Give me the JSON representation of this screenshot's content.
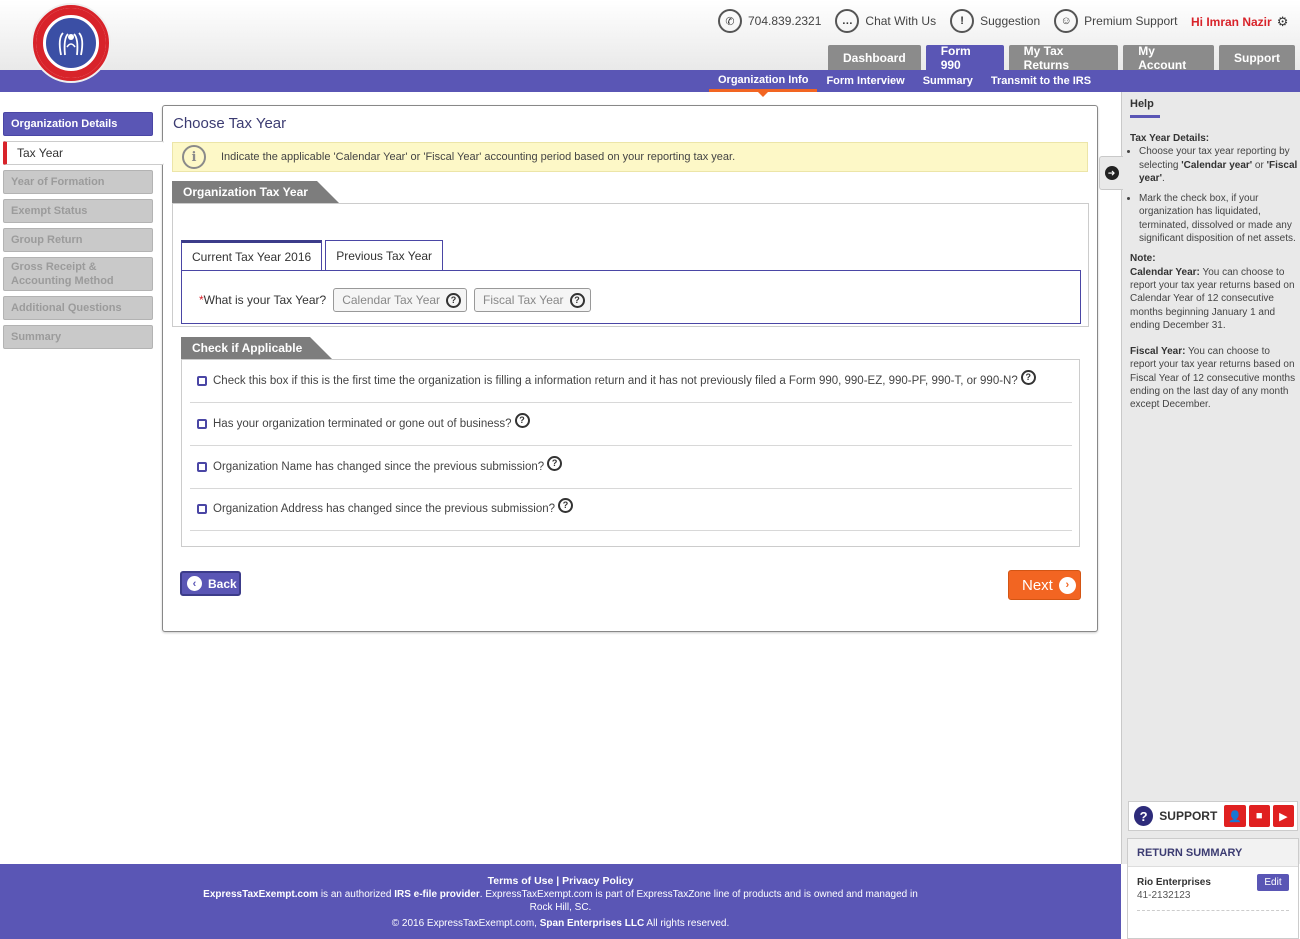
{
  "header": {
    "contact": {
      "phone": "704.839.2321",
      "chat": "Chat With Us",
      "suggestion": "Suggestion",
      "premium": "Premium Support"
    },
    "user_greeting": "Hi Imran Nazir",
    "main_tabs": [
      "Dashboard",
      "Form 990",
      "My Tax Returns",
      "My Account",
      "Support"
    ],
    "active_main_tab": "Form 990",
    "sub_nav": [
      "Organization Info",
      "Form Interview",
      "Summary",
      "Transmit to the IRS"
    ],
    "active_sub_nav": "Organization Info"
  },
  "sidebar": {
    "items": [
      "Organization Details",
      "Tax Year",
      "Year of Formation",
      "Exempt Status",
      "Group Return",
      "Gross Receipt & Accounting Method",
      "Additional Questions",
      "Summary"
    ]
  },
  "main": {
    "title": "Choose Tax Year",
    "info": "Indicate the applicable 'Calendar Year' or 'Fiscal Year' accounting period based on your reporting tax year.",
    "section1": "Organization Tax Year",
    "tabs": [
      "Current Tax Year 2016",
      "Previous Tax Year"
    ],
    "question": "What is your Tax Year?",
    "required_mark": "*",
    "options": [
      "Calendar Tax Year",
      "Fiscal Tax Year"
    ],
    "section2": "Check if Applicable",
    "checks": [
      "Check this box if this is the first time the organization is filling a information return and it has not previously filed a Form 990, 990-EZ, 990-PF, 990-T, or 990-N?",
      "Has your organization terminated or gone out of business?",
      "Organization Name has changed since the previous submission?",
      "Organization Address has changed since the previous submission?"
    ],
    "back_label": "Back",
    "next_label": "Next"
  },
  "help": {
    "title": "Help",
    "tax_year_details_label": "Tax Year Details:",
    "bullet1_pre": "Choose your tax year reporting by selecting ",
    "bullet1_b1": "'Calendar year'",
    "bullet1_mid": " or ",
    "bullet1_b2": "'Fiscal year'",
    "bullet1_post": ".",
    "bullet2": "Mark the check box, if your organization has liquidated, terminated, dissolved or made any significant disposition of net assets.",
    "note_label": "Note:",
    "calendar_label": "Calendar Year:",
    "calendar_text": " You can choose to report your tax year returns based on Calendar Year of 12 consecutive months beginning January 1 and ending December 31.",
    "fiscal_label": "Fiscal Year:",
    "fiscal_text": " You can choose to report your tax year returns based on Fiscal Year of 12 consecutive months ending on the last day of any month except December."
  },
  "support_box": {
    "label": "SUPPORT"
  },
  "return_summary": {
    "title": "RETURN SUMMARY",
    "org_name": "Rio Enterprises",
    "ein": "41-2132123",
    "edit_label": "Edit"
  },
  "footer": {
    "terms": "Terms of Use",
    "sep": "|",
    "privacy": "Privacy Policy",
    "site": "ExpressTaxExempt.com",
    "line2_a": " is an authorized ",
    "irs": "IRS e-file provider",
    "line2_b": ". ExpressTaxExempt.com is part of ExpressTaxZone line of products and is owned and managed in",
    "line3": "Rock Hill, SC.",
    "copyright_pre": "© 2016 ExpressTaxExempt.com, ",
    "company": "Span Enterprises LLC",
    "copyright_post": " All rights reserved."
  },
  "colors": {
    "brand": "#5a56b5",
    "accent": "#f26522",
    "alert": "#d8232a",
    "info_bg": "#fdf8c7"
  },
  "icons": {
    "phone": "phone-icon",
    "chat": "chat-icon",
    "suggestion": "suggestion-icon",
    "premium": "premium-support-icon",
    "settings": "gear-icon",
    "info": "info-icon",
    "help_toggle": "arrow-right-circle-icon"
  }
}
